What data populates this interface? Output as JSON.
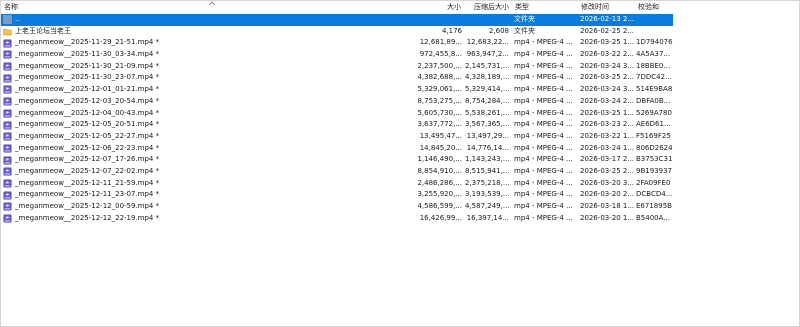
{
  "columns": {
    "name": "名称",
    "size": "大小",
    "packed": "压缩后大小",
    "type": "类型",
    "modified": "修改时间",
    "crc": "校验和"
  },
  "rows": [
    {
      "name": "..",
      "size": "",
      "packed": "",
      "type": "文件夹",
      "modified": "2026-02-13 2...",
      "crc": "",
      "icon": "parent-folder-icon",
      "selected": true
    },
    {
      "name": "上老王论坛当老王",
      "size": "4,176",
      "packed": "2,608",
      "type": "文件夹",
      "modified": "2026-02-25 2...",
      "crc": "",
      "icon": "folder-icon",
      "selected": false
    },
    {
      "name": "_meganmeow__2025-11-29_21-51.mp4 *",
      "size": "12,681,89...",
      "packed": "12,683,22...",
      "type": "mp4 - MPEG-4 ...",
      "modified": "2026-03-25 1...",
      "crc": "1D794076",
      "icon": "video-file-icon"
    },
    {
      "name": "_meganmeow__2025-11-30_03-34.mp4 *",
      "size": "972,455,8...",
      "packed": "963,947,2...",
      "type": "mp4 - MPEG-4 ...",
      "modified": "2026-03-22 2...",
      "crc": "4A5A37...",
      "icon": "video-file-icon"
    },
    {
      "name": "_meganmeow__2025-11-30_21-09.mp4 *",
      "size": "2,237,500,...",
      "packed": "2,145,731,...",
      "type": "mp4 - MPEG-4 ...",
      "modified": "2026-03-24 3...",
      "crc": "18BBE0...",
      "icon": "video-file-icon"
    },
    {
      "name": "_meganmeow__2025-11-30_23-07.mp4 *",
      "size": "4,382,688,...",
      "packed": "4,328,189,...",
      "type": "mp4 - MPEG-4 ...",
      "modified": "2026-03-25 2...",
      "crc": "7DDC42...",
      "icon": "video-file-icon"
    },
    {
      "name": "_meganmeow__2025-12-01_01-21.mp4 *",
      "size": "5,329,061,...",
      "packed": "5,329,414,...",
      "type": "mp4 - MPEG-4 ...",
      "modified": "2026-03-24 3...",
      "crc": "514E9BA8",
      "icon": "video-file-icon"
    },
    {
      "name": "_meganmeow__2025-12-03_20-54.mp4 *",
      "size": "8,753,275,...",
      "packed": "8,754,284,...",
      "type": "mp4 - MPEG-4 ...",
      "modified": "2026-03-24 2...",
      "crc": "DBFA0B...",
      "icon": "video-file-icon"
    },
    {
      "name": "_meganmeow__2025-12-04_00-43.mp4 *",
      "size": "5,605,730,...",
      "packed": "5,538,261,...",
      "type": "mp4 - MPEG-4 ...",
      "modified": "2026-03-25 1...",
      "crc": "5269A780",
      "icon": "video-file-icon"
    },
    {
      "name": "_meganmeow__2025-12-05_20-51.mp4 *",
      "size": "3,637,772,...",
      "packed": "3,567,365,...",
      "type": "mp4 - MPEG-4 ...",
      "modified": "2026-03-23 2...",
      "crc": "AE6D61...",
      "icon": "video-file-icon"
    },
    {
      "name": "_meganmeow__2025-12-05_22-27.mp4 *",
      "size": "13,495,47...",
      "packed": "13,497,29...",
      "type": "mp4 - MPEG-4 ...",
      "modified": "2026-03-22 1...",
      "crc": "F5169F25",
      "icon": "video-file-icon"
    },
    {
      "name": "_meganmeow__2025-12-06_22-23.mp4 *",
      "size": "14,845,20...",
      "packed": "14,776,14...",
      "type": "mp4 - MPEG-4 ...",
      "modified": "2026-03-24 1...",
      "crc": "806D2624",
      "icon": "video-file-icon"
    },
    {
      "name": "_meganmeow__2025-12-07_17-26.mp4 *",
      "size": "1,146,490,...",
      "packed": "1,143,243,...",
      "type": "mp4 - MPEG-4 ...",
      "modified": "2026-03-17 2...",
      "crc": "B3753C31",
      "icon": "video-file-icon"
    },
    {
      "name": "_meganmeow__2025-12-07_22-02.mp4 *",
      "size": "8,854,910,...",
      "packed": "8,515,941,...",
      "type": "mp4 - MPEG-4 ...",
      "modified": "2026-03-25 2...",
      "crc": "9B193937",
      "icon": "video-file-icon"
    },
    {
      "name": "_meganmeow__2025-12-11_21-59.mp4 *",
      "size": "2,486,286,...",
      "packed": "2,375,218,...",
      "type": "mp4 - MPEG-4 ...",
      "modified": "2026-03-20 3...",
      "crc": "2FA09FE0",
      "icon": "video-file-icon"
    },
    {
      "name": "_meganmeow__2025-12-11_23-07.mp4 *",
      "size": "3,255,920,...",
      "packed": "3,193,539,...",
      "type": "mp4 - MPEG-4 ...",
      "modified": "2026-03-20 2...",
      "crc": "DCBCD4...",
      "icon": "video-file-icon"
    },
    {
      "name": "_meganmeow__2025-12-12_00-59.mp4 *",
      "size": "4,586,599,...",
      "packed": "4,587,249,...",
      "type": "mp4 - MPEG-4 ...",
      "modified": "2026-03-18 1...",
      "crc": "E671895B",
      "icon": "video-file-icon"
    },
    {
      "name": "_meganmeow__2025-12-12_22-19.mp4 *",
      "size": "16,426,99...",
      "packed": "16,397,14...",
      "type": "mp4 - MPEG-4 ...",
      "modified": "2026-03-20 1...",
      "crc": "B5400A...",
      "icon": "video-file-icon"
    }
  ],
  "colors": {
    "selection": "#0a7be0",
    "folder": "#f0c24b",
    "video_icon_primary": "#4a3fb0",
    "video_icon_accent": "#7a6fe0"
  }
}
